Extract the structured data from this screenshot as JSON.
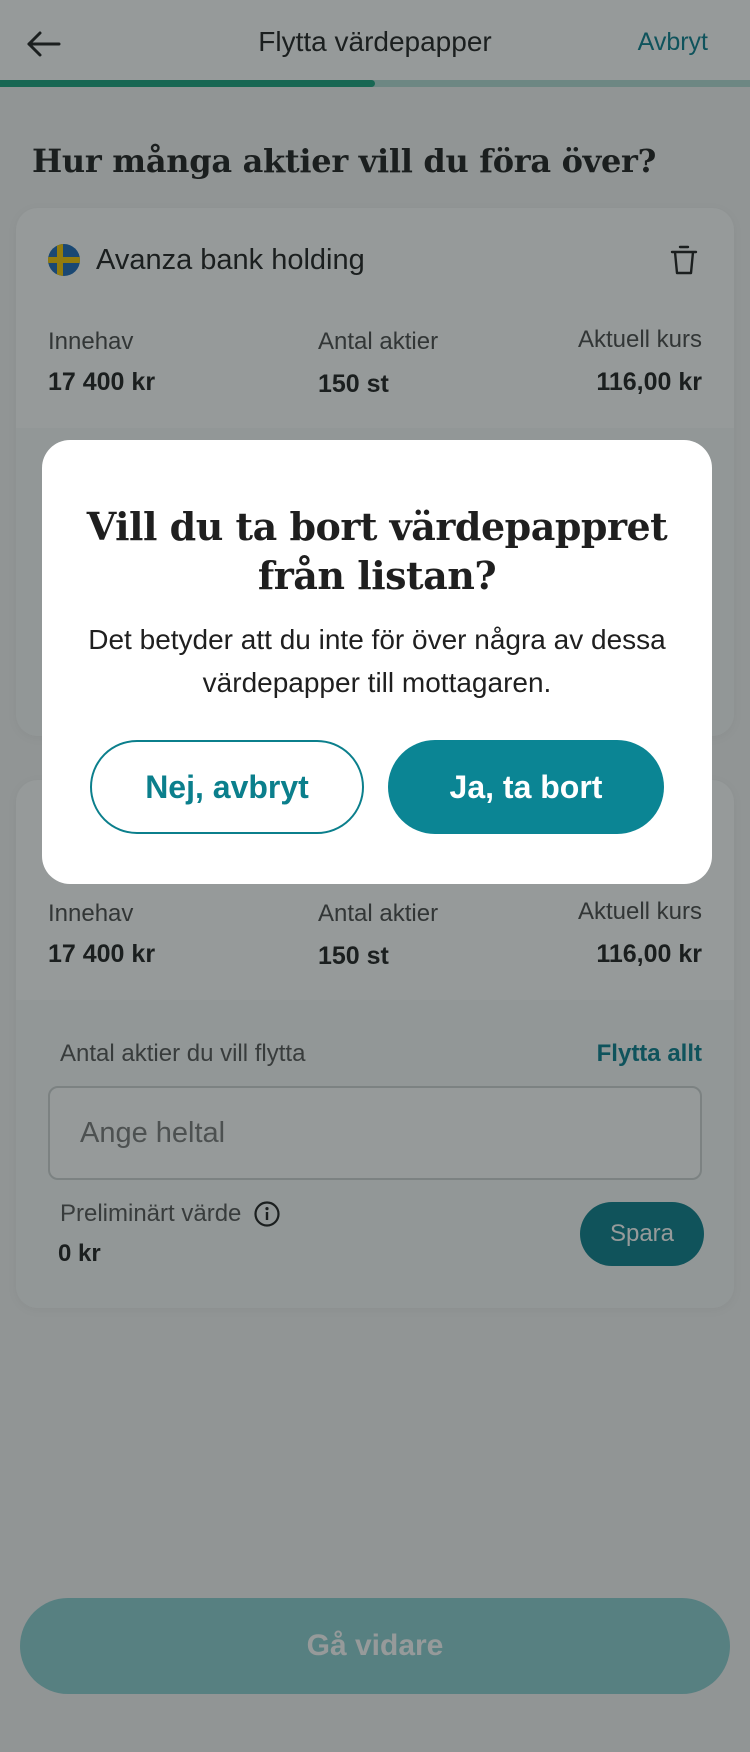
{
  "header": {
    "title": "Flytta värdepapper",
    "cancel_label": "Avbryt",
    "progress_fraction": 0.5
  },
  "question": "Hur många aktier vill du föra över?",
  "holdings": [
    {
      "name": "Avanza bank holding",
      "flag": "sweden-flag-icon",
      "holding_label": "Innehav",
      "holding_value": "17 400 kr",
      "shares_label": "Antal aktier",
      "shares_value": "150 st",
      "price_label": "Aktuell kurs",
      "price_value": "116,00 kr"
    },
    {
      "holding_label": "Innehav",
      "holding_value": "17 400 kr",
      "shares_label": "Antal aktier",
      "shares_value": "150 st",
      "price_label": "Aktuell kurs",
      "price_value": "116,00 kr",
      "move_label": "Antal aktier du vill flytta",
      "move_all_label": "Flytta allt",
      "input_placeholder": "Ange heltal",
      "prelim_label": "Preliminärt värde",
      "prelim_value": "0 kr",
      "save_label": "Spara"
    }
  ],
  "next_label": "Gå vidare",
  "dialog": {
    "title": "Vill du ta bort värdepappret från listan?",
    "body": "Det betyder att du inte för över några av dessa värdepapper till mottagaren.",
    "cancel_label": "Nej, avbryt",
    "confirm_label": "Ja, ta bort"
  },
  "colors": {
    "accent": "#0b7f8c",
    "progress": "#1aa37e",
    "disabled_button": "#8dcfd2"
  }
}
